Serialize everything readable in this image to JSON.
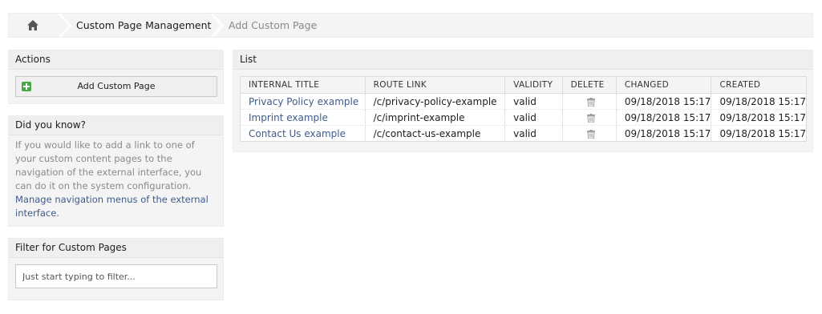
{
  "breadcrumb": {
    "home_icon": "home-icon",
    "items": [
      "Custom Page Management",
      "Add Custom Page"
    ]
  },
  "actions": {
    "title": "Actions",
    "add_button": "Add Custom Page",
    "add_icon": "plus-icon"
  },
  "did_you_know": {
    "title": "Did you know?",
    "text": "If you would like to add a link to one of your custom content pages to the navigation of the external interface, you can do it on the system configuration. ",
    "link": "Manage navigation menus of the external interface."
  },
  "filter": {
    "title": "Filter for Custom Pages",
    "placeholder": "Just start typing to filter..."
  },
  "list": {
    "title": "List",
    "columns": [
      "INTERNAL TITLE",
      "ROUTE LINK",
      "VALIDITY",
      "DELETE",
      "CHANGED",
      "CREATED"
    ],
    "rows": [
      {
        "title": "Privacy Policy example",
        "route": "/c/privacy-policy-example",
        "validity": "valid",
        "delete_icon": "trash-icon",
        "changed": "09/18/2018 15:17",
        "created": "09/18/2018 15:17"
      },
      {
        "title": "Imprint example",
        "route": "/c/imprint-example",
        "validity": "valid",
        "delete_icon": "trash-icon",
        "changed": "09/18/2018 15:17",
        "created": "09/18/2018 15:17"
      },
      {
        "title": "Contact Us example",
        "route": "/c/contact-us-example",
        "validity": "valid",
        "delete_icon": "trash-icon",
        "changed": "09/18/2018 15:17",
        "created": "09/18/2018 15:17"
      }
    ]
  },
  "colors": {
    "link": "#3e5b8a",
    "box_bg": "#f4f4f4",
    "add_icon": "#4aa84a"
  }
}
